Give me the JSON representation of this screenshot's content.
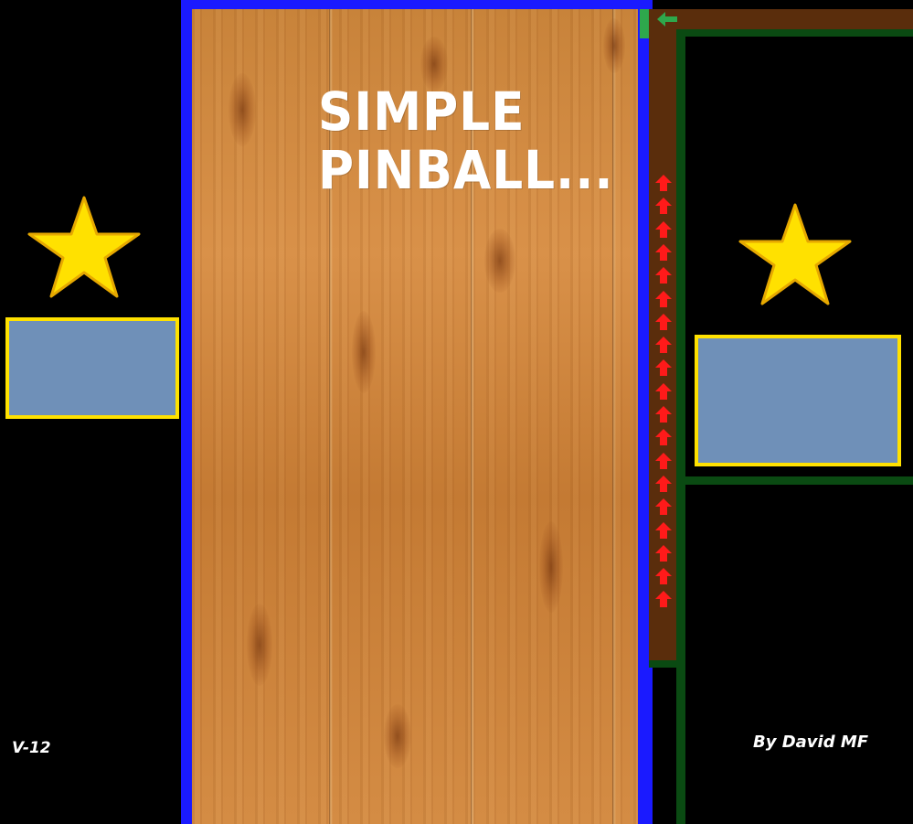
{
  "game": {
    "title_lines": [
      "SIMPLE",
      "PINBALL..."
    ],
    "version": "V-12",
    "author": "By David MF"
  },
  "colors": {
    "playfield_border": "#1a1aff",
    "wood": "#d08a42",
    "lane": "#5a2d0c",
    "rail_green": "#0a4a12",
    "gate_green": "#2ea84c",
    "arrow_red": "#ff1a1a",
    "panel_fill": "#6f90b8",
    "panel_border": "#ffe100",
    "star": "#ffe100"
  },
  "icons": {
    "lane_arrows": "red-up-arrow-icon",
    "lane_arrow_count": 19,
    "back_arrow": "green-left-arrow-icon",
    "stars": "star-icon"
  }
}
